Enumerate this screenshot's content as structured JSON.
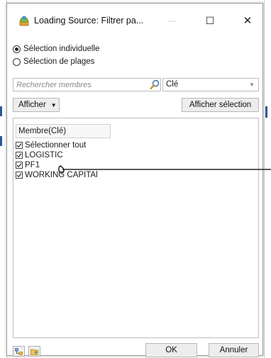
{
  "window": {
    "title": "Loading Source: Filtrer pa...",
    "minimize_symbol": "—",
    "maximize_symbol": "☐",
    "close_symbol": "✕",
    "icon": "app-icon"
  },
  "selection_mode": {
    "options": [
      {
        "label": "Sélection individuelle",
        "checked": true
      },
      {
        "label": "Sélection de plages",
        "checked": false
      }
    ]
  },
  "search": {
    "placeholder": "Rechercher membres",
    "value": "",
    "icon": "search-icon"
  },
  "key_select": {
    "value": "Clé"
  },
  "toolbar": {
    "afficher_label": "Afficher",
    "afficher_caret": "▼",
    "afficher_selection_label": "Afficher sélection"
  },
  "members": {
    "column_header": "Membre(Clé)",
    "items": [
      {
        "label": "Sélectionner tout",
        "checked": true
      },
      {
        "label": "LOGISTIC",
        "checked": true
      },
      {
        "label": "PF1",
        "checked": true
      },
      {
        "label": "WORKING CAPITAl",
        "checked": true
      }
    ]
  },
  "footer": {
    "ok_label": "OK",
    "cancel_label": "Annuler"
  },
  "colors": {
    "selection_blue": "#2b579a",
    "border": "#bcbcbc",
    "button_bg": "#ededed"
  }
}
